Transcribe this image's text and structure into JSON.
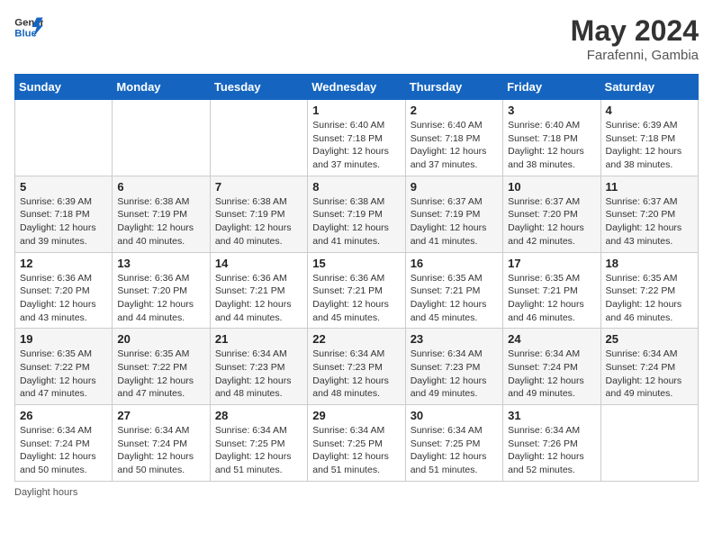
{
  "header": {
    "logo_line1": "General",
    "logo_line2": "Blue",
    "month_year": "May 2024",
    "location": "Farafenni, Gambia"
  },
  "weekdays": [
    "Sunday",
    "Monday",
    "Tuesday",
    "Wednesday",
    "Thursday",
    "Friday",
    "Saturday"
  ],
  "weeks": [
    [
      {
        "day": "",
        "detail": ""
      },
      {
        "day": "",
        "detail": ""
      },
      {
        "day": "",
        "detail": ""
      },
      {
        "day": "1",
        "detail": "Sunrise: 6:40 AM\nSunset: 7:18 PM\nDaylight: 12 hours\nand 37 minutes."
      },
      {
        "day": "2",
        "detail": "Sunrise: 6:40 AM\nSunset: 7:18 PM\nDaylight: 12 hours\nand 37 minutes."
      },
      {
        "day": "3",
        "detail": "Sunrise: 6:40 AM\nSunset: 7:18 PM\nDaylight: 12 hours\nand 38 minutes."
      },
      {
        "day": "4",
        "detail": "Sunrise: 6:39 AM\nSunset: 7:18 PM\nDaylight: 12 hours\nand 38 minutes."
      }
    ],
    [
      {
        "day": "5",
        "detail": "Sunrise: 6:39 AM\nSunset: 7:18 PM\nDaylight: 12 hours\nand 39 minutes."
      },
      {
        "day": "6",
        "detail": "Sunrise: 6:38 AM\nSunset: 7:19 PM\nDaylight: 12 hours\nand 40 minutes."
      },
      {
        "day": "7",
        "detail": "Sunrise: 6:38 AM\nSunset: 7:19 PM\nDaylight: 12 hours\nand 40 minutes."
      },
      {
        "day": "8",
        "detail": "Sunrise: 6:38 AM\nSunset: 7:19 PM\nDaylight: 12 hours\nand 41 minutes."
      },
      {
        "day": "9",
        "detail": "Sunrise: 6:37 AM\nSunset: 7:19 PM\nDaylight: 12 hours\nand 41 minutes."
      },
      {
        "day": "10",
        "detail": "Sunrise: 6:37 AM\nSunset: 7:20 PM\nDaylight: 12 hours\nand 42 minutes."
      },
      {
        "day": "11",
        "detail": "Sunrise: 6:37 AM\nSunset: 7:20 PM\nDaylight: 12 hours\nand 43 minutes."
      }
    ],
    [
      {
        "day": "12",
        "detail": "Sunrise: 6:36 AM\nSunset: 7:20 PM\nDaylight: 12 hours\nand 43 minutes."
      },
      {
        "day": "13",
        "detail": "Sunrise: 6:36 AM\nSunset: 7:20 PM\nDaylight: 12 hours\nand 44 minutes."
      },
      {
        "day": "14",
        "detail": "Sunrise: 6:36 AM\nSunset: 7:21 PM\nDaylight: 12 hours\nand 44 minutes."
      },
      {
        "day": "15",
        "detail": "Sunrise: 6:36 AM\nSunset: 7:21 PM\nDaylight: 12 hours\nand 45 minutes."
      },
      {
        "day": "16",
        "detail": "Sunrise: 6:35 AM\nSunset: 7:21 PM\nDaylight: 12 hours\nand 45 minutes."
      },
      {
        "day": "17",
        "detail": "Sunrise: 6:35 AM\nSunset: 7:21 PM\nDaylight: 12 hours\nand 46 minutes."
      },
      {
        "day": "18",
        "detail": "Sunrise: 6:35 AM\nSunset: 7:22 PM\nDaylight: 12 hours\nand 46 minutes."
      }
    ],
    [
      {
        "day": "19",
        "detail": "Sunrise: 6:35 AM\nSunset: 7:22 PM\nDaylight: 12 hours\nand 47 minutes."
      },
      {
        "day": "20",
        "detail": "Sunrise: 6:35 AM\nSunset: 7:22 PM\nDaylight: 12 hours\nand 47 minutes."
      },
      {
        "day": "21",
        "detail": "Sunrise: 6:34 AM\nSunset: 7:23 PM\nDaylight: 12 hours\nand 48 minutes."
      },
      {
        "day": "22",
        "detail": "Sunrise: 6:34 AM\nSunset: 7:23 PM\nDaylight: 12 hours\nand 48 minutes."
      },
      {
        "day": "23",
        "detail": "Sunrise: 6:34 AM\nSunset: 7:23 PM\nDaylight: 12 hours\nand 49 minutes."
      },
      {
        "day": "24",
        "detail": "Sunrise: 6:34 AM\nSunset: 7:24 PM\nDaylight: 12 hours\nand 49 minutes."
      },
      {
        "day": "25",
        "detail": "Sunrise: 6:34 AM\nSunset: 7:24 PM\nDaylight: 12 hours\nand 49 minutes."
      }
    ],
    [
      {
        "day": "26",
        "detail": "Sunrise: 6:34 AM\nSunset: 7:24 PM\nDaylight: 12 hours\nand 50 minutes."
      },
      {
        "day": "27",
        "detail": "Sunrise: 6:34 AM\nSunset: 7:24 PM\nDaylight: 12 hours\nand 50 minutes."
      },
      {
        "day": "28",
        "detail": "Sunrise: 6:34 AM\nSunset: 7:25 PM\nDaylight: 12 hours\nand 51 minutes."
      },
      {
        "day": "29",
        "detail": "Sunrise: 6:34 AM\nSunset: 7:25 PM\nDaylight: 12 hours\nand 51 minutes."
      },
      {
        "day": "30",
        "detail": "Sunrise: 6:34 AM\nSunset: 7:25 PM\nDaylight: 12 hours\nand 51 minutes."
      },
      {
        "day": "31",
        "detail": "Sunrise: 6:34 AM\nSunset: 7:26 PM\nDaylight: 12 hours\nand 52 minutes."
      },
      {
        "day": "",
        "detail": ""
      }
    ]
  ],
  "footer": {
    "daylight_label": "Daylight hours"
  }
}
